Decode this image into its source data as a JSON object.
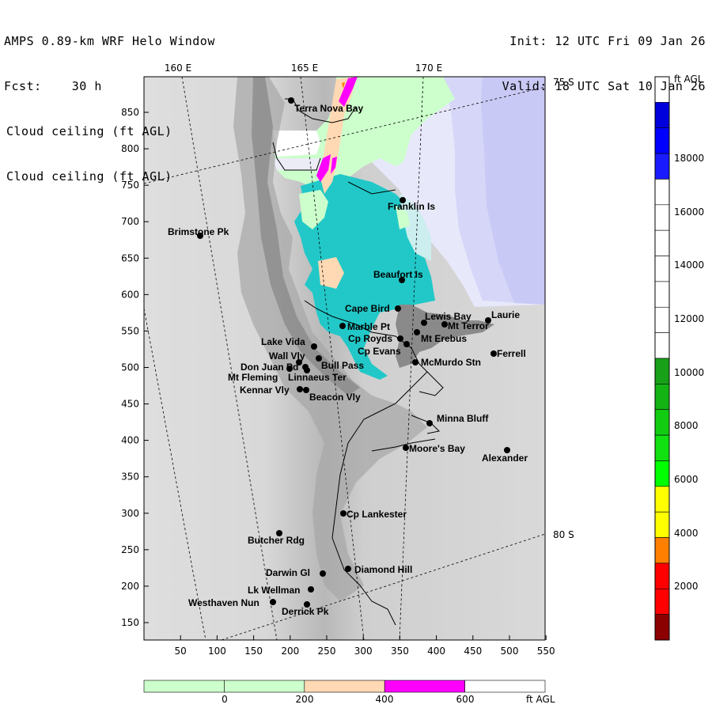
{
  "header": {
    "title": "AMPS 0.89-km WRF Helo Window",
    "forecast": "Fcst:    30 h",
    "field_1": "Cloud ceiling (ft AGL)",
    "field_2": "Cloud ceiling (ft AGL)",
    "init": "Init: 12 UTC Fri 09 Jan 26",
    "valid": "Valid: 18 UTC Sat 10 Jan 26"
  },
  "map": {
    "x_ticks": [
      "50",
      "100",
      "150",
      "200",
      "250",
      "300",
      "350",
      "400",
      "450",
      "500",
      "550"
    ],
    "y_ticks": [
      "850",
      "800",
      "750",
      "700",
      "650",
      "600",
      "550",
      "500",
      "450",
      "400",
      "350",
      "300",
      "250",
      "200",
      "150"
    ],
    "lon_labels": [
      "160 E",
      "165 E",
      "170 E"
    ],
    "lat_labels": [
      "75 S",
      "80 S"
    ],
    "stations": [
      {
        "name": "Terra Nova Bay"
      },
      {
        "name": "Franklin Is"
      },
      {
        "name": "Brimstone Pk"
      },
      {
        "name": "Beaufort Is"
      },
      {
        "name": "Cape Bird"
      },
      {
        "name": "Lewis Bay"
      },
      {
        "name": "Laurie"
      },
      {
        "name": "Mt Terror"
      },
      {
        "name": "Marble Pt"
      },
      {
        "name": "Cp Royds"
      },
      {
        "name": "Mt Erebus"
      },
      {
        "name": "Lake Vida"
      },
      {
        "name": "Cp Evans"
      },
      {
        "name": "Ferrell"
      },
      {
        "name": "Wall Vly"
      },
      {
        "name": "Don Juan Pd"
      },
      {
        "name": "Bull Pass"
      },
      {
        "name": "McMurdo Stn"
      },
      {
        "name": "Mt Fleming"
      },
      {
        "name": "Linnaeus Ter"
      },
      {
        "name": "Kennar Vly"
      },
      {
        "name": "Beacon Vly"
      },
      {
        "name": "Minna Bluff"
      },
      {
        "name": "Moore's Bay"
      },
      {
        "name": "Alexander"
      },
      {
        "name": "Cp Lankester"
      },
      {
        "name": "Butcher Rdg"
      },
      {
        "name": "Darwin Gl"
      },
      {
        "name": "Diamond Hill"
      },
      {
        "name": "Lk Wellman"
      },
      {
        "name": "Westhaven Nun"
      },
      {
        "name": "Derrick Pk"
      }
    ]
  },
  "colorbar_vertical": {
    "unit": "ft AGL",
    "labels": [
      "18000",
      "16000",
      "14000",
      "12000",
      "10000",
      "8000",
      "6000",
      "4000",
      "2000"
    ],
    "colors": [
      "#ffffff",
      "#0000dd",
      "#0000ff",
      "#1a1aff",
      "#ffffff",
      "#ffffff",
      "#ffffff",
      "#ffffff",
      "#ffffff",
      "#ffffff",
      "#ffffff",
      "#18a018",
      "#13b313",
      "#12cc12",
      "#11e011",
      "#00ff00",
      "#ffff00",
      "#ffff00",
      "#ff8000",
      "#ff0000",
      "#ff0000",
      "#8b0000"
    ]
  },
  "colorbar_horizontal": {
    "unit": "ft AGL",
    "labels": [
      "0",
      "200",
      "400",
      "600"
    ],
    "colors": [
      "#ccffcc",
      "#ccffcc",
      "#ffd9b3",
      "#ff00ff",
      "#ffffff"
    ]
  }
}
